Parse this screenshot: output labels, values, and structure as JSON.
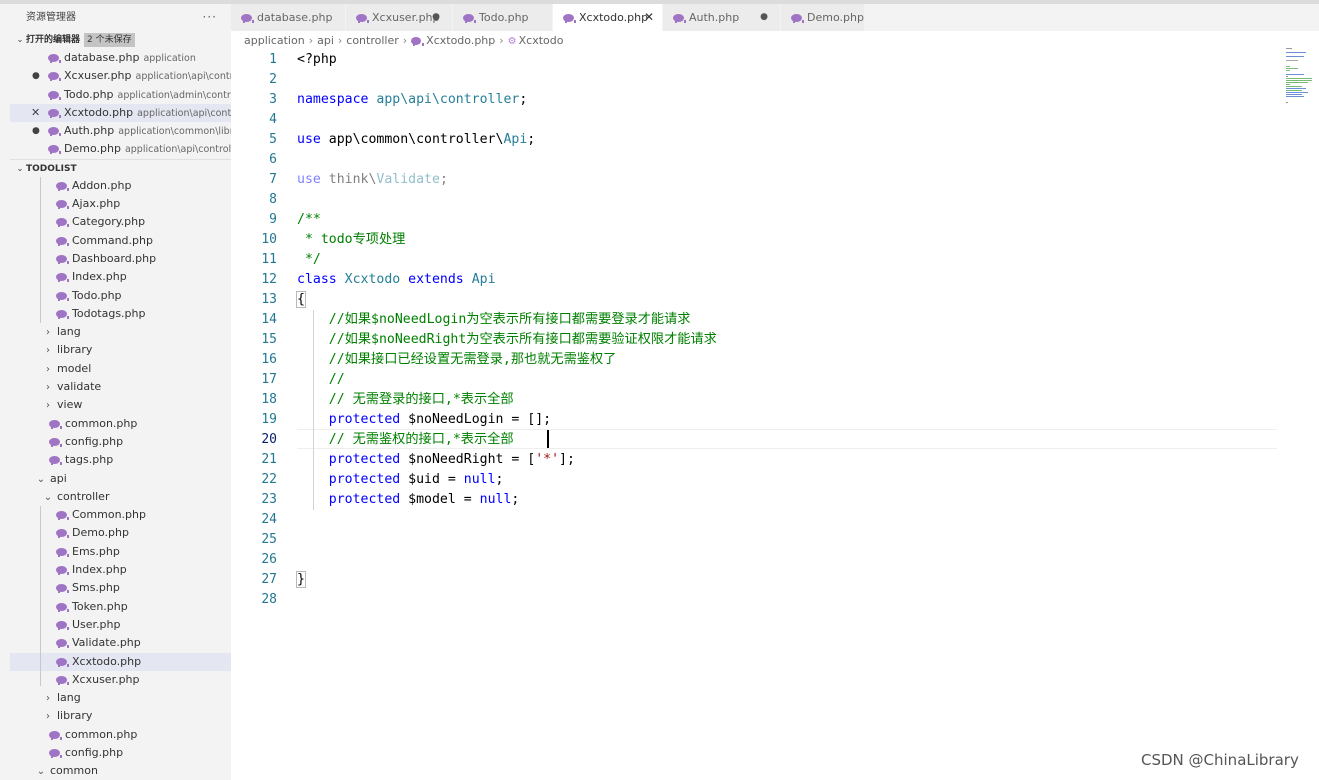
{
  "explorer": {
    "title": "资源管理器",
    "more": "···",
    "open_editors": {
      "label": "打开的编辑器",
      "badge": "2 个未保存",
      "items": [
        {
          "name": "database.php",
          "desc": "application",
          "state": ""
        },
        {
          "name": "Xcxuser.php",
          "desc": "application\\api\\control...",
          "state": "dot"
        },
        {
          "name": "Todo.php",
          "desc": "application\\admin\\contro...",
          "state": ""
        },
        {
          "name": "Xcxtodo.php",
          "desc": "application\\api\\contr...",
          "state": "close"
        },
        {
          "name": "Auth.php",
          "desc": "application\\common\\libr...",
          "state": "dot"
        },
        {
          "name": "Demo.php",
          "desc": "application\\api\\controller",
          "state": ""
        }
      ]
    },
    "workspace": {
      "label": "TODOLIST",
      "tree": [
        {
          "label": "Addon.php",
          "kind": "file",
          "depth": 2
        },
        {
          "label": "Ajax.php",
          "kind": "file",
          "depth": 2
        },
        {
          "label": "Category.php",
          "kind": "file",
          "depth": 2
        },
        {
          "label": "Command.php",
          "kind": "file",
          "depth": 2
        },
        {
          "label": "Dashboard.php",
          "kind": "file",
          "depth": 2
        },
        {
          "label": "Index.php",
          "kind": "file",
          "depth": 2
        },
        {
          "label": "Todo.php",
          "kind": "file",
          "depth": 2
        },
        {
          "label": "Todotags.php",
          "kind": "file",
          "depth": 2
        },
        {
          "label": "lang",
          "kind": "folder",
          "depth": 1
        },
        {
          "label": "library",
          "kind": "folder",
          "depth": 1
        },
        {
          "label": "model",
          "kind": "folder",
          "depth": 1
        },
        {
          "label": "validate",
          "kind": "folder",
          "depth": 1
        },
        {
          "label": "view",
          "kind": "folder",
          "depth": 1
        },
        {
          "label": "common.php",
          "kind": "file",
          "depth": 1
        },
        {
          "label": "config.php",
          "kind": "file",
          "depth": 1
        },
        {
          "label": "tags.php",
          "kind": "file",
          "depth": 1
        },
        {
          "label": "api",
          "kind": "folder-open",
          "depth": 0
        },
        {
          "label": "controller",
          "kind": "folder-open",
          "depth": 1
        },
        {
          "label": "Common.php",
          "kind": "file",
          "depth": 2
        },
        {
          "label": "Demo.php",
          "kind": "file",
          "depth": 2
        },
        {
          "label": "Ems.php",
          "kind": "file",
          "depth": 2
        },
        {
          "label": "Index.php",
          "kind": "file",
          "depth": 2
        },
        {
          "label": "Sms.php",
          "kind": "file",
          "depth": 2
        },
        {
          "label": "Token.php",
          "kind": "file",
          "depth": 2
        },
        {
          "label": "User.php",
          "kind": "file",
          "depth": 2
        },
        {
          "label": "Validate.php",
          "kind": "file",
          "depth": 2
        },
        {
          "label": "Xcxtodo.php",
          "kind": "file",
          "depth": 2,
          "selected": true
        },
        {
          "label": "Xcxuser.php",
          "kind": "file",
          "depth": 2
        },
        {
          "label": "lang",
          "kind": "folder",
          "depth": 1
        },
        {
          "label": "library",
          "kind": "folder",
          "depth": 1
        },
        {
          "label": "common.php",
          "kind": "file",
          "depth": 1
        },
        {
          "label": "config.php",
          "kind": "file",
          "depth": 1
        },
        {
          "label": "common",
          "kind": "folder-open",
          "depth": 0
        }
      ]
    }
  },
  "tabs": [
    {
      "label": "database.php",
      "state": ""
    },
    {
      "label": "Xcxuser.php",
      "state": "dot"
    },
    {
      "label": "Todo.php",
      "state": ""
    },
    {
      "label": "Xcxtodo.php",
      "state": "active"
    },
    {
      "label": "Auth.php",
      "state": "dot"
    },
    {
      "label": "Demo.php",
      "state": ""
    }
  ],
  "breadcrumb": {
    "parts": [
      "application",
      "api",
      "controller",
      "Xcxtodo.php",
      "Xcxtodo"
    ]
  },
  "editor": {
    "current_line": 20,
    "lines": [
      [
        {
          "t": "<?php",
          "c": ""
        }
      ],
      [],
      [
        {
          "t": "namespace ",
          "c": "kw"
        },
        {
          "t": "app\\api\\controller",
          "c": "ty"
        },
        {
          "t": ";",
          "c": ""
        }
      ],
      [],
      [
        {
          "t": "use ",
          "c": "kw"
        },
        {
          "t": "app\\common\\controller\\",
          "c": ""
        },
        {
          "t": "Api",
          "c": "ty"
        },
        {
          "t": ";",
          "c": ""
        }
      ],
      [],
      [
        {
          "t": "use ",
          "c": "kw dim"
        },
        {
          "t": "think\\",
          "c": "dim"
        },
        {
          "t": "Validate",
          "c": "ty dim"
        },
        {
          "t": ";",
          "c": "dim"
        }
      ],
      [],
      [
        {
          "t": "/**",
          "c": "cm"
        }
      ],
      [
        {
          "t": " * todo专项处理",
          "c": "cm"
        }
      ],
      [
        {
          "t": " */",
          "c": "cm"
        }
      ],
      [
        {
          "t": "class ",
          "c": "kw"
        },
        {
          "t": "Xcxtodo ",
          "c": "ty"
        },
        {
          "t": "extends ",
          "c": "kw"
        },
        {
          "t": "Api",
          "c": "ty"
        }
      ],
      [
        {
          "t": "{",
          "c": "brk"
        }
      ],
      [
        {
          "t": "    //如果$noNeedLogin为空表示所有接口都需要登录才能请求",
          "c": "cm"
        }
      ],
      [
        {
          "t": "    //如果$noNeedRight为空表示所有接口都需要验证权限才能请求",
          "c": "cm"
        }
      ],
      [
        {
          "t": "    //如果接口已经设置无需登录,那也就无需鉴权了",
          "c": "cm"
        }
      ],
      [
        {
          "t": "    //",
          "c": "cm"
        }
      ],
      [
        {
          "t": "    // 无需登录的接口,*表示全部",
          "c": "cm"
        }
      ],
      [
        {
          "t": "    ",
          "c": ""
        },
        {
          "t": "protected ",
          "c": "kw"
        },
        {
          "t": "$noNeedLogin",
          "c": ""
        },
        {
          "t": " = ",
          "c": ""
        },
        {
          "t": "[]",
          "c": ""
        },
        {
          "t": ";",
          "c": ""
        }
      ],
      [
        {
          "t": "    // 无需鉴权的接口,*表示全部",
          "c": "cm"
        }
      ],
      [
        {
          "t": "    ",
          "c": ""
        },
        {
          "t": "protected ",
          "c": "kw"
        },
        {
          "t": "$noNeedRight",
          "c": ""
        },
        {
          "t": " = [",
          "c": ""
        },
        {
          "t": "'*'",
          "c": "str"
        },
        {
          "t": "];",
          "c": ""
        }
      ],
      [
        {
          "t": "    ",
          "c": ""
        },
        {
          "t": "protected ",
          "c": "kw"
        },
        {
          "t": "$uid",
          "c": ""
        },
        {
          "t": " = ",
          "c": ""
        },
        {
          "t": "null",
          "c": "kw"
        },
        {
          "t": ";",
          "c": ""
        }
      ],
      [
        {
          "t": "    ",
          "c": ""
        },
        {
          "t": "protected ",
          "c": "kw"
        },
        {
          "t": "$model",
          "c": ""
        },
        {
          "t": " = ",
          "c": ""
        },
        {
          "t": "null",
          "c": "kw"
        },
        {
          "t": ";",
          "c": ""
        }
      ],
      [],
      [],
      [],
      [
        {
          "t": "}",
          "c": "brk"
        }
      ],
      []
    ]
  },
  "watermark": "CSDN @ChinaLibrary"
}
